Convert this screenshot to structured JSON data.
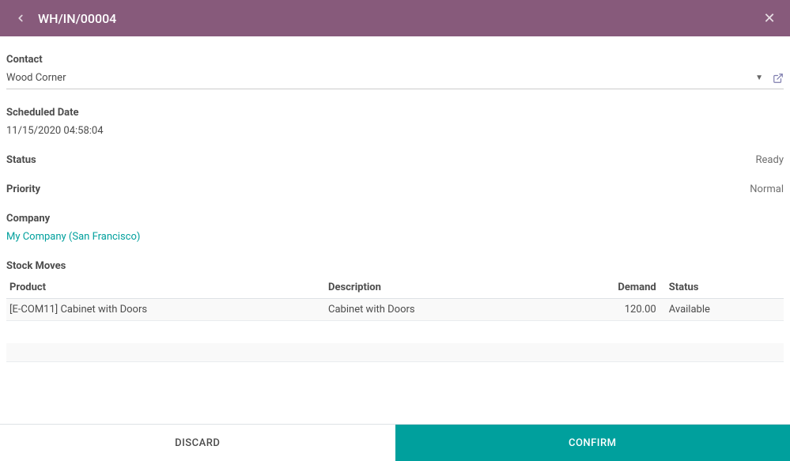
{
  "header": {
    "title": "WH/IN/00004"
  },
  "fields": {
    "contact": {
      "label": "Contact",
      "value": "Wood Corner"
    },
    "scheduled_date": {
      "label": "Scheduled Date",
      "value": "11/15/2020 04:58:04"
    },
    "status": {
      "label": "Status",
      "value": "Ready"
    },
    "priority": {
      "label": "Priority",
      "value": "Normal"
    },
    "company": {
      "label": "Company",
      "value": "My Company (San Francisco)"
    }
  },
  "stock_moves": {
    "label": "Stock Moves",
    "headers": {
      "product": "Product",
      "description": "Description",
      "demand": "Demand",
      "status": "Status"
    },
    "rows": [
      {
        "product": "[E-COM11] Cabinet with Doors",
        "description": "Cabinet with Doors",
        "demand": "120.00",
        "status": "Available"
      }
    ]
  },
  "footer": {
    "discard": "Discard",
    "confirm": "Confirm"
  }
}
